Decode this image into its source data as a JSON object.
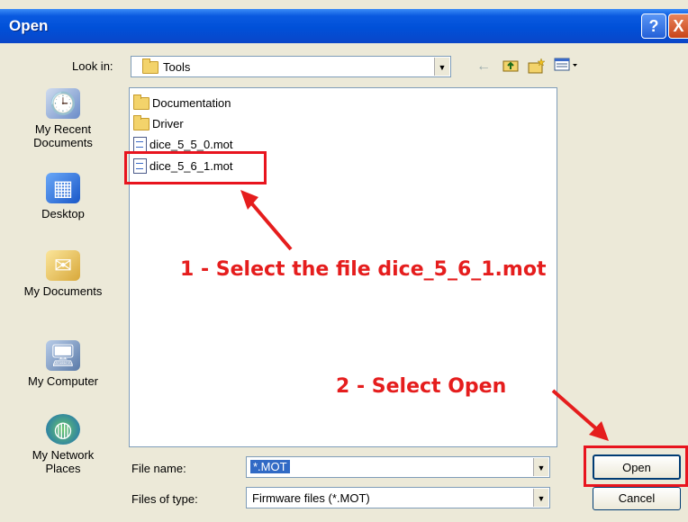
{
  "window": {
    "title": "Open",
    "help_glyph": "?",
    "close_glyph": "X",
    "top_glyph": "‾‾"
  },
  "look_in": {
    "label": "Look in:",
    "value": "Tools"
  },
  "places": [
    {
      "label_line1": "My Recent",
      "label_line2": "Documents",
      "icon": "recent-documents-icon"
    },
    {
      "label_line1": "Desktop",
      "label_line2": "",
      "icon": "desktop-icon"
    },
    {
      "label_line1": "My Documents",
      "label_line2": "",
      "icon": "my-documents-icon"
    },
    {
      "label_line1": "My Computer",
      "label_line2": "",
      "icon": "my-computer-icon"
    },
    {
      "label_line1": "My Network",
      "label_line2": "Places",
      "icon": "network-places-icon"
    }
  ],
  "files": [
    {
      "name": "Documentation",
      "type": "folder"
    },
    {
      "name": "Driver",
      "type": "folder"
    },
    {
      "name": "dice_5_5_0.mot",
      "type": "file"
    },
    {
      "name": "dice_5_6_1.mot",
      "type": "file"
    }
  ],
  "file_name": {
    "label": "File name:",
    "value": "*.MOT"
  },
  "file_type": {
    "label": "Files of type:",
    "value": "Firmware files (*.MOT)"
  },
  "buttons": {
    "open": "Open",
    "cancel": "Cancel"
  },
  "annotations": {
    "step1": "1 - Select the file dice_5_6_1.mot",
    "step2": "2 - Select Open"
  },
  "colors": {
    "annotation": "#e51d1d",
    "title_bar": "#0a5ae0"
  }
}
